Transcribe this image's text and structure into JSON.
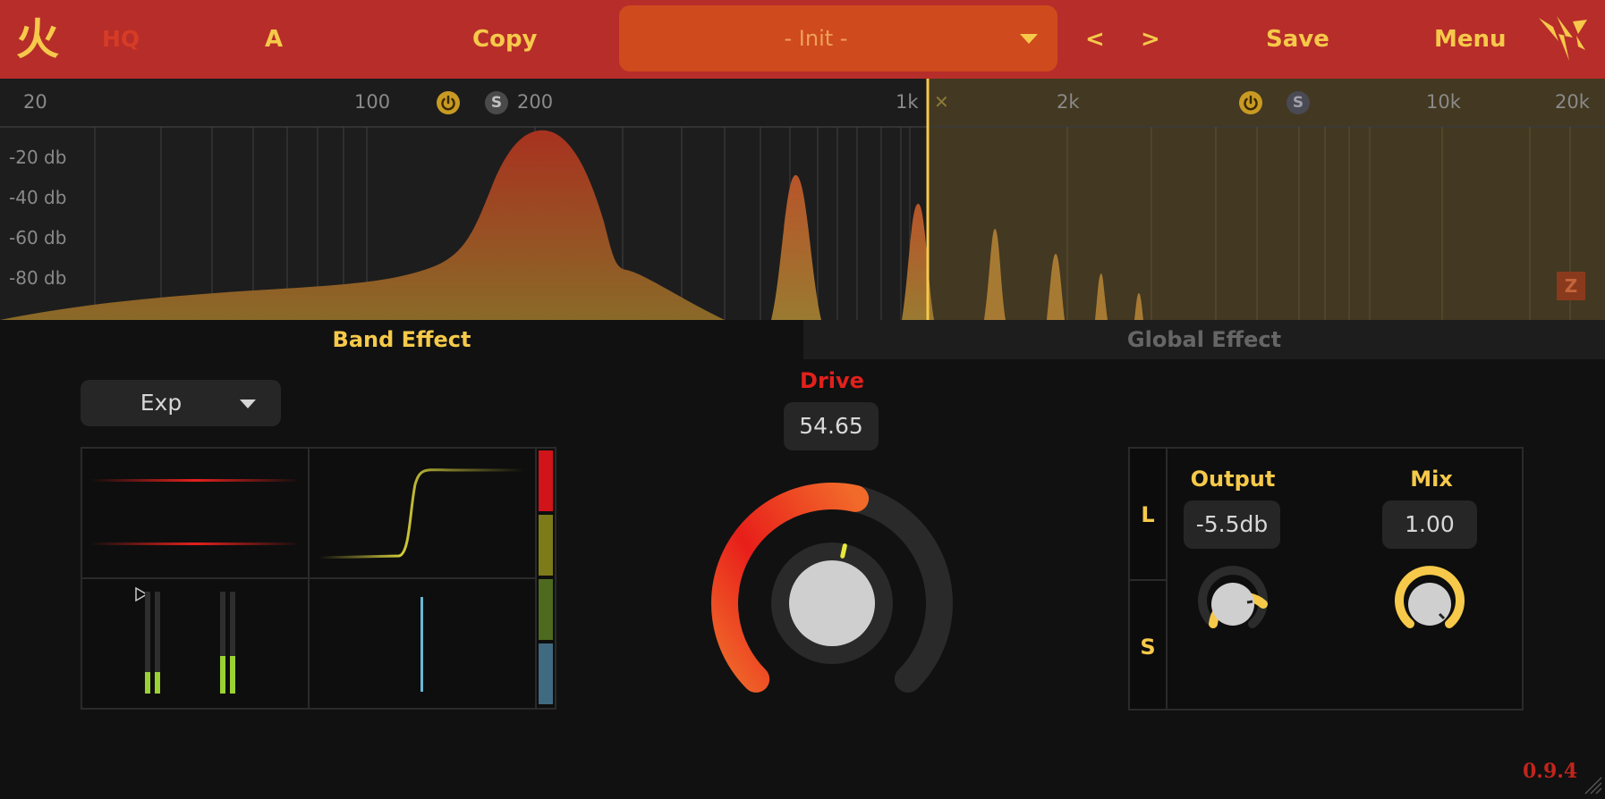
{
  "header": {
    "logo_glyph": "火",
    "hq_label": "HQ",
    "ab_label": "A",
    "copy_label": "Copy",
    "preset_name": "- Init -",
    "prev_label": "<",
    "next_label": ">",
    "save_label": "Save",
    "menu_label": "Menu"
  },
  "spectrum": {
    "freq_labels": [
      "20",
      "100",
      "200",
      "1k",
      "2k",
      "10k",
      "20k"
    ],
    "db_labels": [
      "-20 db",
      "-40 db",
      "-60 db",
      "-80 db"
    ],
    "band1": {
      "power_icon": "power-icon",
      "solo_label": "S"
    },
    "band2": {
      "power_icon": "power-icon",
      "solo_label": "S"
    },
    "crossover_remove": "✕",
    "zoom_label": "Z"
  },
  "tabs": {
    "band": "Band Effect",
    "global": "Global Effect"
  },
  "band_effect": {
    "mode": "Exp"
  },
  "drive": {
    "label": "Drive",
    "value": "54.65",
    "value_fraction": 0.5465
  },
  "output": {
    "label": "Output",
    "value": "-5.5db"
  },
  "mix": {
    "label": "Mix",
    "value": "1.00"
  },
  "channel": {
    "left": "L",
    "side": "S"
  },
  "version": "0.9.4",
  "colors": {
    "header_bg": "#b72d2a",
    "accent_yellow": "#f6c94a",
    "drive_red": "#e3201c",
    "preset_bg": "#cf4a1d"
  }
}
